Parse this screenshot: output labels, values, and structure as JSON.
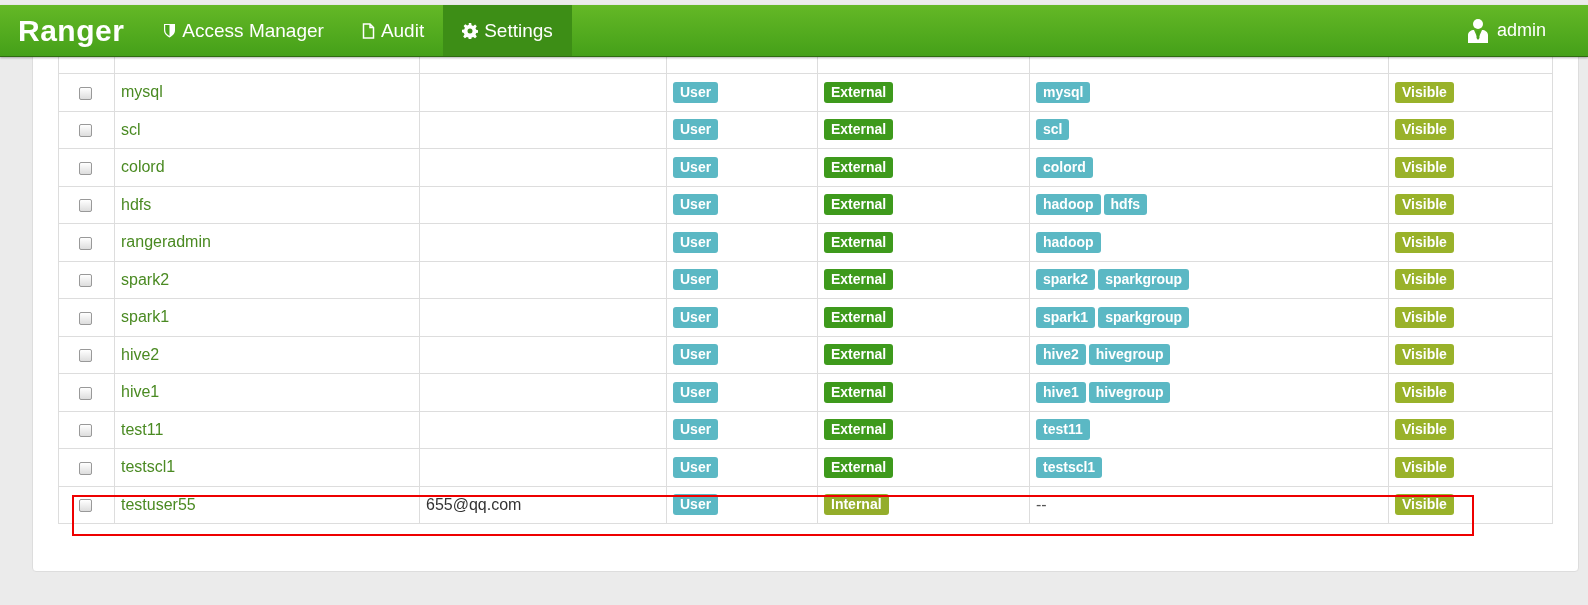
{
  "navbar": {
    "brand": "Ranger",
    "items": [
      {
        "label": "Access Manager",
        "selected": false
      },
      {
        "label": "Audit",
        "selected": false
      },
      {
        "label": "Settings",
        "selected": true
      }
    ],
    "user": "admin"
  },
  "table": {
    "rows": [
      {
        "checked": false,
        "name": "mysql",
        "email": "",
        "role": "User",
        "source": {
          "label": "External",
          "kind": "external"
        },
        "groups": [
          "mysql"
        ],
        "visibility": "Visible",
        "highlighted": false
      },
      {
        "checked": false,
        "name": "scl",
        "email": "",
        "role": "User",
        "source": {
          "label": "External",
          "kind": "external"
        },
        "groups": [
          "scl"
        ],
        "visibility": "Visible",
        "highlighted": false
      },
      {
        "checked": false,
        "name": "colord",
        "email": "",
        "role": "User",
        "source": {
          "label": "External",
          "kind": "external"
        },
        "groups": [
          "colord"
        ],
        "visibility": "Visible",
        "highlighted": false
      },
      {
        "checked": false,
        "name": "hdfs",
        "email": "",
        "role": "User",
        "source": {
          "label": "External",
          "kind": "external"
        },
        "groups": [
          "hadoop",
          "hdfs"
        ],
        "visibility": "Visible",
        "highlighted": false
      },
      {
        "checked": false,
        "name": "rangeradmin",
        "email": "",
        "role": "User",
        "source": {
          "label": "External",
          "kind": "external"
        },
        "groups": [
          "hadoop"
        ],
        "visibility": "Visible",
        "highlighted": false
      },
      {
        "checked": false,
        "name": "spark2",
        "email": "",
        "role": "User",
        "source": {
          "label": "External",
          "kind": "external"
        },
        "groups": [
          "spark2",
          "sparkgroup"
        ],
        "visibility": "Visible",
        "highlighted": false
      },
      {
        "checked": false,
        "name": "spark1",
        "email": "",
        "role": "User",
        "source": {
          "label": "External",
          "kind": "external"
        },
        "groups": [
          "spark1",
          "sparkgroup"
        ],
        "visibility": "Visible",
        "highlighted": false
      },
      {
        "checked": false,
        "name": "hive2",
        "email": "",
        "role": "User",
        "source": {
          "label": "External",
          "kind": "external"
        },
        "groups": [
          "hive2",
          "hivegroup"
        ],
        "visibility": "Visible",
        "highlighted": false
      },
      {
        "checked": false,
        "name": "hive1",
        "email": "",
        "role": "User",
        "source": {
          "label": "External",
          "kind": "external"
        },
        "groups": [
          "hive1",
          "hivegroup"
        ],
        "visibility": "Visible",
        "highlighted": false
      },
      {
        "checked": false,
        "name": "test11",
        "email": "",
        "role": "User",
        "source": {
          "label": "External",
          "kind": "external"
        },
        "groups": [
          "test11"
        ],
        "visibility": "Visible",
        "highlighted": false
      },
      {
        "checked": false,
        "name": "testscl1",
        "email": "",
        "role": "User",
        "source": {
          "label": "External",
          "kind": "external"
        },
        "groups": [
          "testscl1"
        ],
        "visibility": "Visible",
        "highlighted": false
      },
      {
        "checked": false,
        "name": "testuser55",
        "email": "655@qq.com",
        "role": "User",
        "source": {
          "label": "Internal",
          "kind": "internal"
        },
        "groups": [],
        "groups_empty": "--",
        "visibility": "Visible",
        "highlighted": true
      }
    ]
  }
}
